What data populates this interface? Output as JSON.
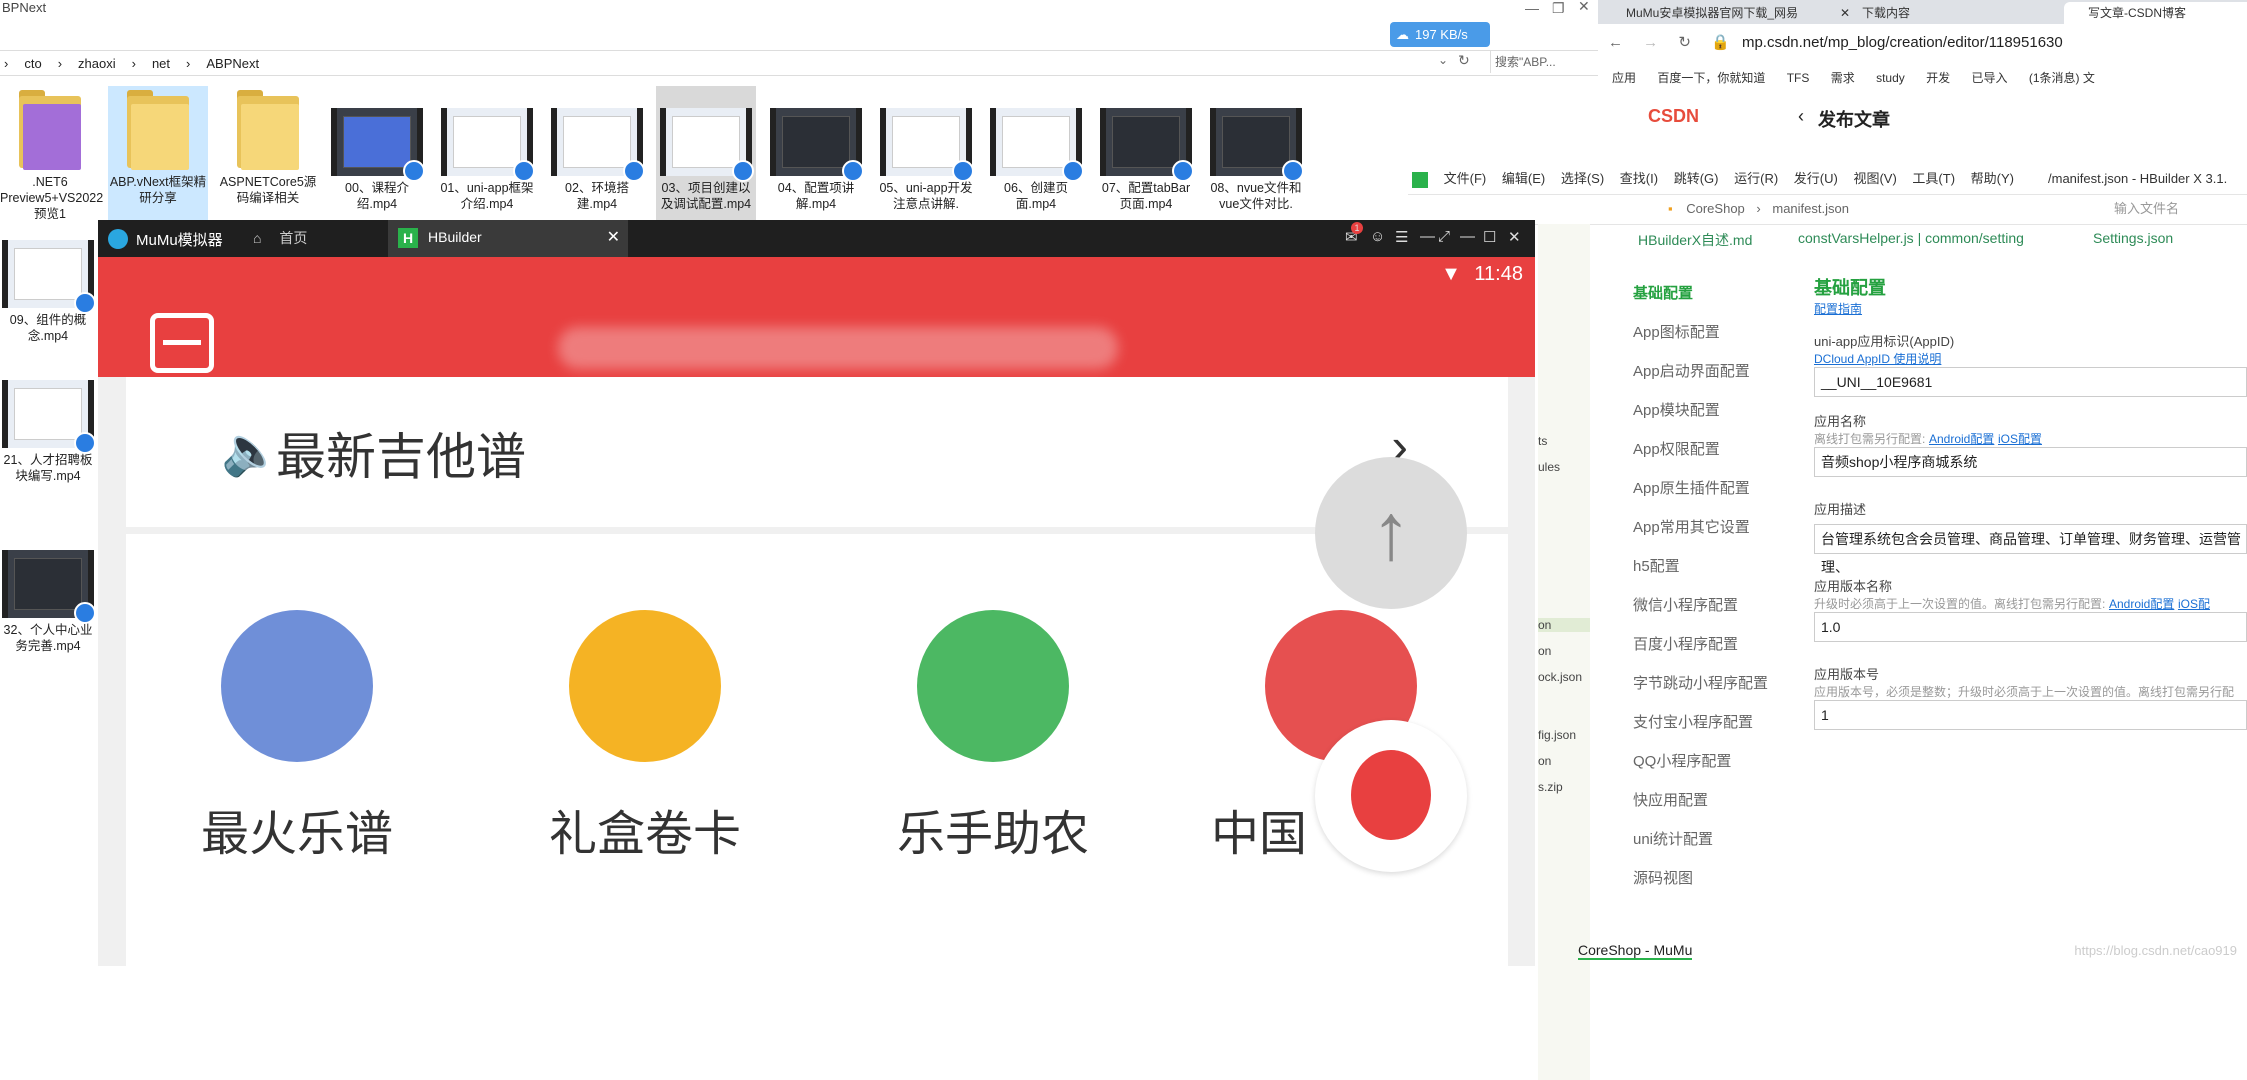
{
  "explorer": {
    "title_fragment": "BPNext",
    "speed": "197 KB/s",
    "breadcrumbs": [
      "cto",
      "zhaoxi",
      "net",
      "ABPNext"
    ],
    "search_placeholder": "搜索\"ABP...",
    "files_row": [
      {
        "name": ".NET6 Preview5+VS2022预览1",
        "kind": "folder"
      },
      {
        "name": "ABP.vNext框架精研分享",
        "kind": "folder"
      },
      {
        "name": "ASPNETCore5源码编译相关",
        "kind": "folder"
      },
      {
        "name": "00、课程介绍.mp4",
        "kind": "video"
      },
      {
        "name": "01、uni-app框架介绍.mp4",
        "kind": "video"
      },
      {
        "name": "02、环境搭建.mp4",
        "kind": "video"
      },
      {
        "name": "03、项目创建以及调试配置.mp4",
        "kind": "video"
      },
      {
        "name": "04、配置项讲解.mp4",
        "kind": "video"
      },
      {
        "name": "05、uni-app开发注意点讲解.",
        "kind": "video"
      },
      {
        "name": "06、创建页面.mp4",
        "kind": "video"
      },
      {
        "name": "07、配置tabBar页面.mp4",
        "kind": "video"
      },
      {
        "name": "08、nvue文件和vue文件对比.",
        "kind": "video"
      }
    ],
    "files_col": [
      {
        "name": "09、组件的概念.mp4"
      },
      {
        "name": "21、人才招聘板块编写.mp4"
      },
      {
        "name": "32、个人中心业务完善.mp4"
      }
    ]
  },
  "emulator": {
    "title": "MuMu模拟器",
    "tab_home": "首页",
    "tab_hbuilder": "HBuilder",
    "notification_count": "1",
    "time": "11:48",
    "news_title": "最新吉他谱",
    "icons": [
      {
        "label": "最火乐谱",
        "color": "#6f8fd8"
      },
      {
        "label": "礼盒卷卡",
        "color": "#f5b324"
      },
      {
        "label": "乐手助农",
        "color": "#4cb863"
      },
      {
        "label": "中国",
        "color": "#e65050"
      }
    ],
    "header_color": "#e84040"
  },
  "browser": {
    "tabs": [
      "MuMu安卓模拟器官网下载_网易",
      "下载内容",
      "写文章-CSDN博客"
    ],
    "url": "mp.csdn.net/mp_blog/creation/editor/118951630",
    "bookmarks": [
      "应用",
      "百度一下，你就知道",
      "TFS",
      "需求",
      "study",
      "开发",
      "已导入",
      "(1条消息) 文"
    ],
    "brand": "CSDN",
    "page_title": "发布文章"
  },
  "hbuilder": {
    "menu": [
      "文件(F)",
      "编辑(E)",
      "选择(S)",
      "查找(I)",
      "跳转(G)",
      "运行(R)",
      "发行(U)",
      "视图(V)",
      "工具(T)",
      "帮助(Y)"
    ],
    "window_title": "/manifest.json - HBuilder X 3.1.",
    "path": [
      "CoreShop",
      "manifest.json"
    ],
    "file_search_placeholder": "输入文件名",
    "file_fragments": [
      "ts",
      "ules",
      "on",
      "on",
      "ock.json",
      "fig.json",
      "on",
      "s.zip"
    ],
    "tabs": [
      "HBuilderX自述.md",
      "constVarsHelper.js | common/setting",
      "Settings.json"
    ],
    "nav": [
      "基础配置",
      "App图标配置",
      "App启动界面配置",
      "App模块配置",
      "App权限配置",
      "App原生插件配置",
      "App常用其它设置",
      "h5配置",
      "微信小程序配置",
      "百度小程序配置",
      "字节跳动小程序配置",
      "支付宝小程序配置",
      "QQ小程序配置",
      "快应用配置",
      "uni统计配置",
      "源码视图"
    ],
    "panel": {
      "title": "基础配置",
      "guide": "配置指南",
      "appid_label": "uni-app应用标识(AppID)",
      "appid_link": "DCloud AppID 使用说明",
      "appid_value": "__UNI__10E9681",
      "name_label": "应用名称",
      "name_hint": "离线打包需另行配置:",
      "name_android": "Android配置",
      "name_ios": "iOS配置",
      "name_value": "音频shop小程序商城系统",
      "desc_label": "应用描述",
      "desc_value": "台管理系统包含会员管理、商品管理、订单管理、财务管理、运营管理、",
      "ver_label": "应用版本名称",
      "ver_hint": "升级时必须高于上一次设置的值。离线打包需另行配置:",
      "ver_android": "Android配置",
      "ver_ios": "iOS配",
      "ver_value": "1.0",
      "code_label": "应用版本号",
      "code_hint": "应用版本号，必须是整数；升级时必须高于上一次设置的值。离线打包需另行配",
      "code_value": "1"
    },
    "status": "CoreShop - MuMu",
    "watermark": "https://blog.csdn.net/cao919"
  }
}
